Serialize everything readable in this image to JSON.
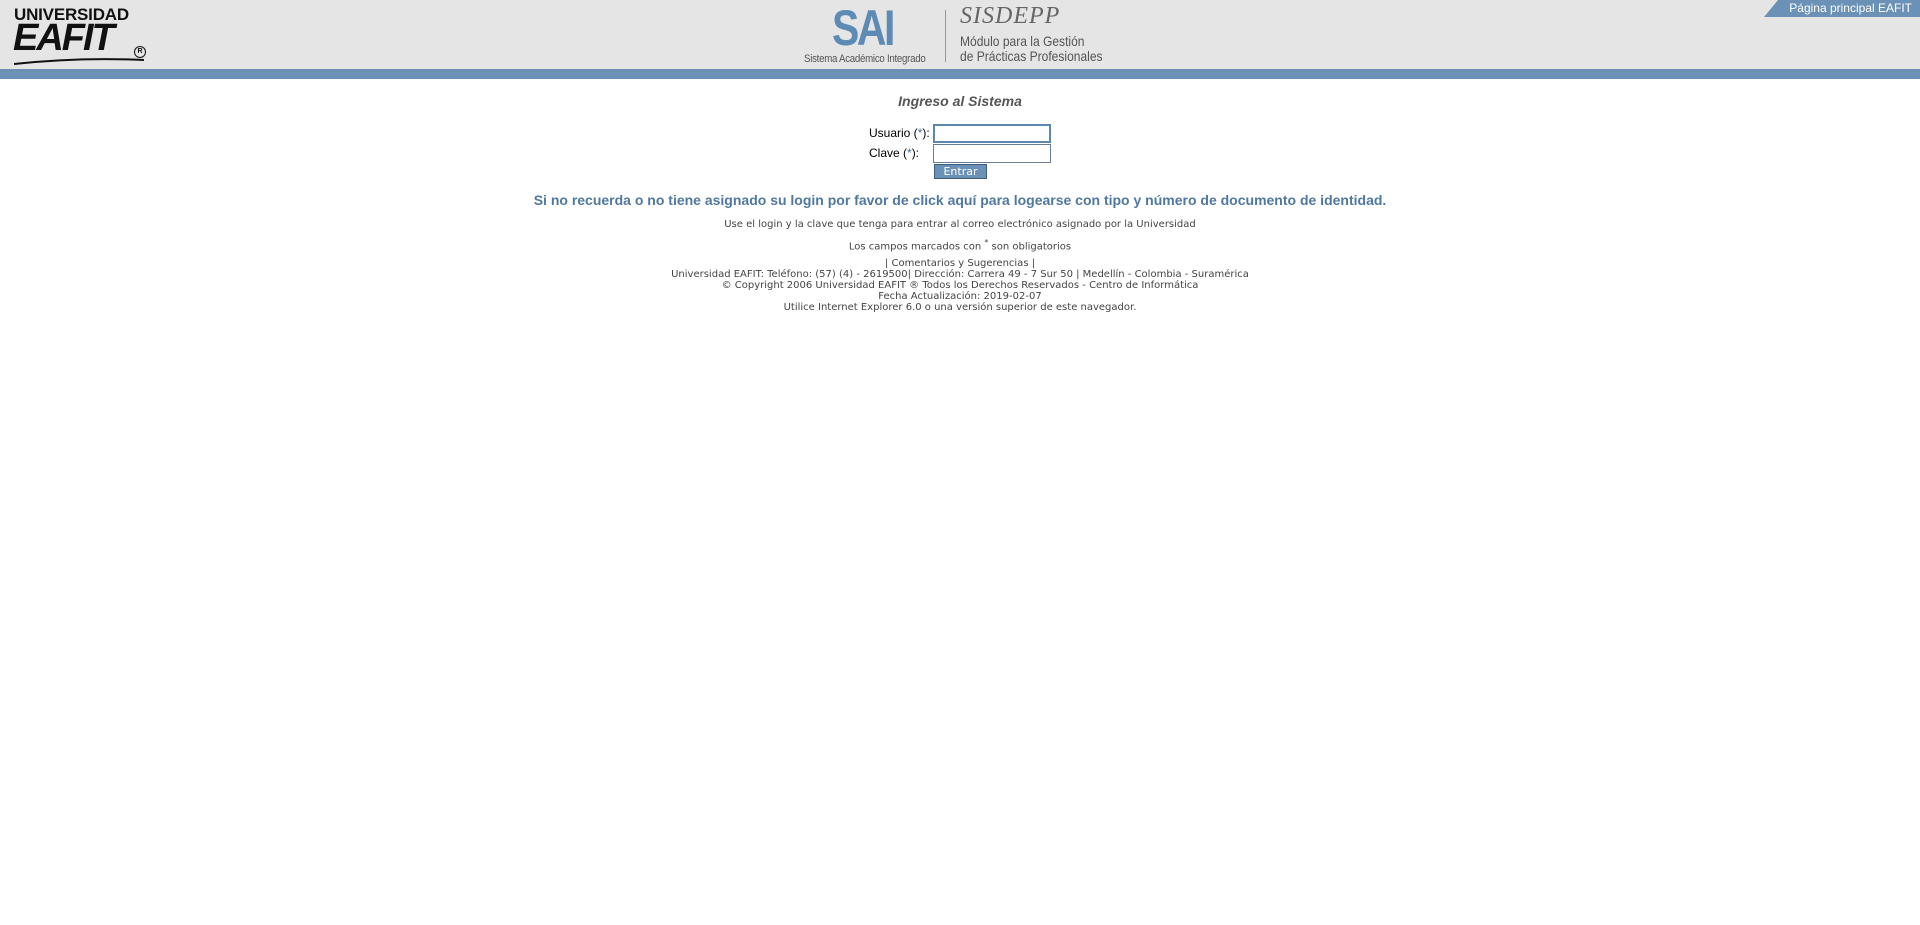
{
  "header": {
    "eafit_logo": {
      "line1": "UNIVERSIDAD",
      "line2": "EAFIT",
      "reg_mark": "R"
    },
    "sai_logo": {
      "text": "SAI",
      "subtitle": "Sistema Académico Integrado"
    },
    "sisdepp_logo": {
      "title": "SISDEPP",
      "subtitle_line1": "Módulo para la Gestión",
      "subtitle_line2": "de Prácticas Profesionales"
    },
    "home_link": "Página principal EAFIT"
  },
  "login": {
    "title": "Ingreso al Sistema",
    "username_label": "Usuario (",
    "username_star": "*",
    "username_label_end": "):",
    "username_value": "",
    "password_label": "Clave (",
    "password_star": "*",
    "password_label_end": "):",
    "password_value": "",
    "submit_label": "Entrar"
  },
  "help_link": "Si no recuerda o no tiene asignado su login por favor de click aquí para logearse con tipo y número de documento de identidad.",
  "notes": {
    "note1": "Use el login y la clave que tenga para entrar al correo electrónico asignado por la Universidad",
    "note2_prefix": "Los campos marcados con ",
    "note2_star": "*",
    "note2_suffix": " son obligatorios"
  },
  "footer": {
    "links_prefix": "| ",
    "feedback_link": "Comentarios y Sugerencias",
    "links_suffix": " |",
    "contact": "Universidad EAFIT: Teléfono: (57) (4) - 2619500| Dirección: Carrera 49 - 7 Sur 50 | Medellín - Colombia - Suramérica",
    "copyright": "© Copyright 2006 Universidad EAFIT ® Todos los Derechos Reservados - Centro de Informática",
    "updated": "Fecha Actualización: 2019-02-07",
    "browser_note": "Utilice Internet Explorer 6.0 o una versión superior de este navegador."
  },
  "colors": {
    "accent": "#6b91b6",
    "header_bg": "#e5e5e5",
    "link": "#50789f"
  }
}
